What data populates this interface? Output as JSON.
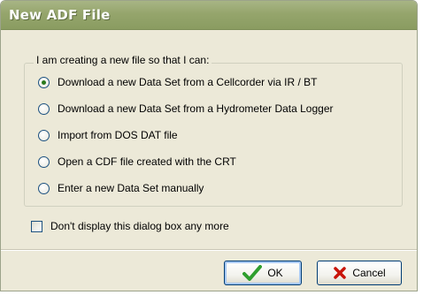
{
  "window": {
    "title": "New ADF File"
  },
  "group": {
    "label": "I am creating a new file so that I can:",
    "options": [
      {
        "label": "Download a new Data Set from a Cellcorder via IR / BT",
        "selected": true
      },
      {
        "label": "Download a new Data Set from a Hydrometer Data Logger",
        "selected": false
      },
      {
        "label": "Import from DOS DAT file",
        "selected": false
      },
      {
        "label": "Open a CDF file created with the CRT",
        "selected": false
      },
      {
        "label": "Enter a new Data Set manually",
        "selected": false
      }
    ]
  },
  "checkbox": {
    "label": "Don't display this dialog box any more",
    "checked": false
  },
  "buttons": {
    "ok_label": "OK",
    "ok_icon": "checkmark-icon",
    "cancel_label": "Cancel",
    "cancel_icon": "x-icon"
  },
  "colors": {
    "titlebar": "#95a56c",
    "dialog_bg": "#ece9d8",
    "ok_check": "#2e9e2e",
    "cancel_x": "#c8140a"
  }
}
